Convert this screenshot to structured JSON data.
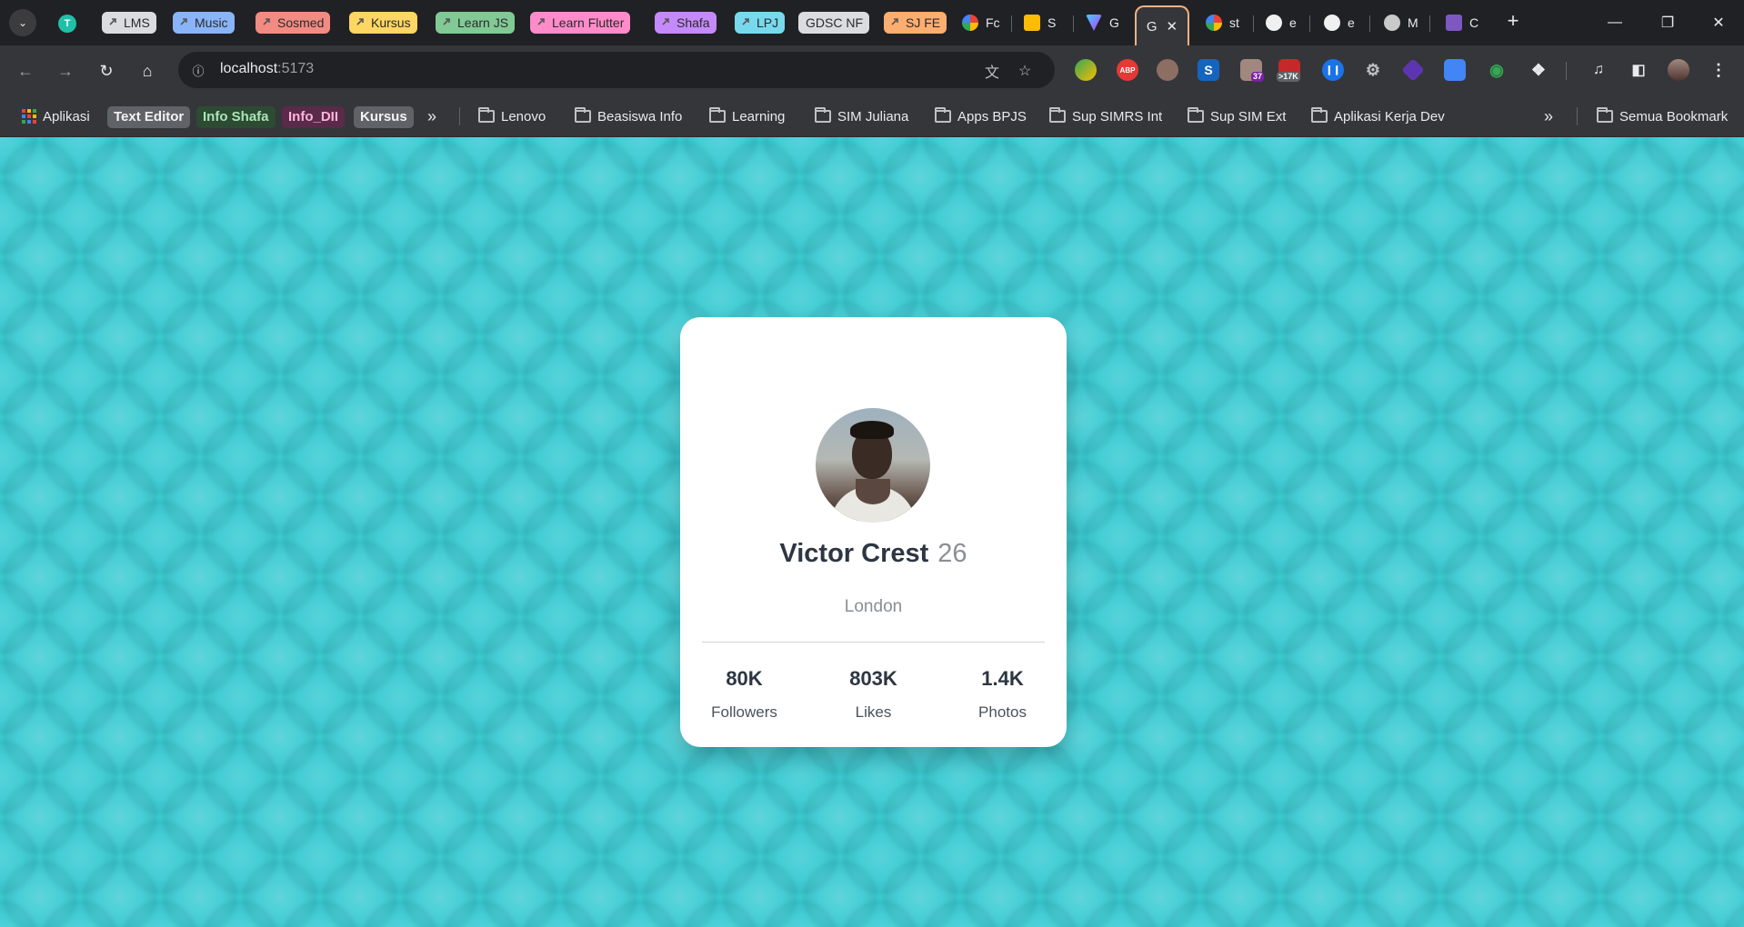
{
  "tabstrip": {
    "group_dot": "T",
    "groups": [
      {
        "label": "LMS",
        "color": "#dadce0"
      },
      {
        "label": "Music",
        "color": "#8ab4f8"
      },
      {
        "label": "Sosmed",
        "color": "#f28b82"
      },
      {
        "label": "Kursus",
        "color": "#fdd663"
      },
      {
        "label": "Learn JS",
        "color": "#81c995"
      },
      {
        "label": "Learn Flutter",
        "color": "#ff8bcb"
      },
      {
        "label": "Shafa",
        "color": "#c58af9"
      },
      {
        "label": "LPJ",
        "color": "#78d9ec"
      },
      {
        "label": "GDSC NF",
        "color": "#dadce0"
      },
      {
        "label": "SJ FE",
        "color": "#fcad70"
      }
    ],
    "mini_tabs": [
      {
        "label": "Fc",
        "icon": "pinwheel-icon"
      },
      {
        "label": "S",
        "icon": "slides-icon"
      },
      {
        "label": "G",
        "icon": "vite-icon"
      },
      {
        "label": "st",
        "icon": "google-icon"
      },
      {
        "label": "e",
        "icon": "github-icon"
      },
      {
        "label": "e",
        "icon": "github-icon"
      },
      {
        "label": "M",
        "icon": "github-icon"
      },
      {
        "label": "C",
        "icon": "list-icon"
      }
    ],
    "active_tab": {
      "label": "G",
      "close": "✕"
    },
    "new_tab": "+"
  },
  "toolbar": {
    "url_host": "localhost",
    "url_port": ":5173"
  },
  "bookmarks": {
    "apps_label": "Aplikasi",
    "chips": [
      {
        "label": "Text Editor",
        "color": "#5f6368"
      },
      {
        "label": "Info Shafa",
        "color": "#2d4a33"
      },
      {
        "label": "Info_DII",
        "color": "#5a2a4a"
      },
      {
        "label": "Kursus",
        "color": "#5f6368"
      }
    ],
    "folders": [
      "Lenovo",
      "Beasiswa Info",
      "Learning",
      "SIM Juliana",
      "Apps BPJS",
      "Sup SIMRS Int",
      "Sup SIM Ext",
      "Aplikasi Kerja Dev"
    ],
    "all_bookmarks": "Semua Bookmark"
  },
  "extensions": {
    "badge_37": "37",
    "badge_17k": ">17K"
  },
  "profile": {
    "name": "Victor Crest",
    "age": "26",
    "city": "London",
    "stats": [
      {
        "value": "80K",
        "label": "Followers"
      },
      {
        "value": "803K",
        "label": "Likes"
      },
      {
        "value": "1.4K",
        "label": "Photos"
      }
    ]
  },
  "colors": {
    "page_background": "#3ccbd3",
    "card_background": "#ffffff",
    "active_tab_outline": "#f4b183"
  }
}
